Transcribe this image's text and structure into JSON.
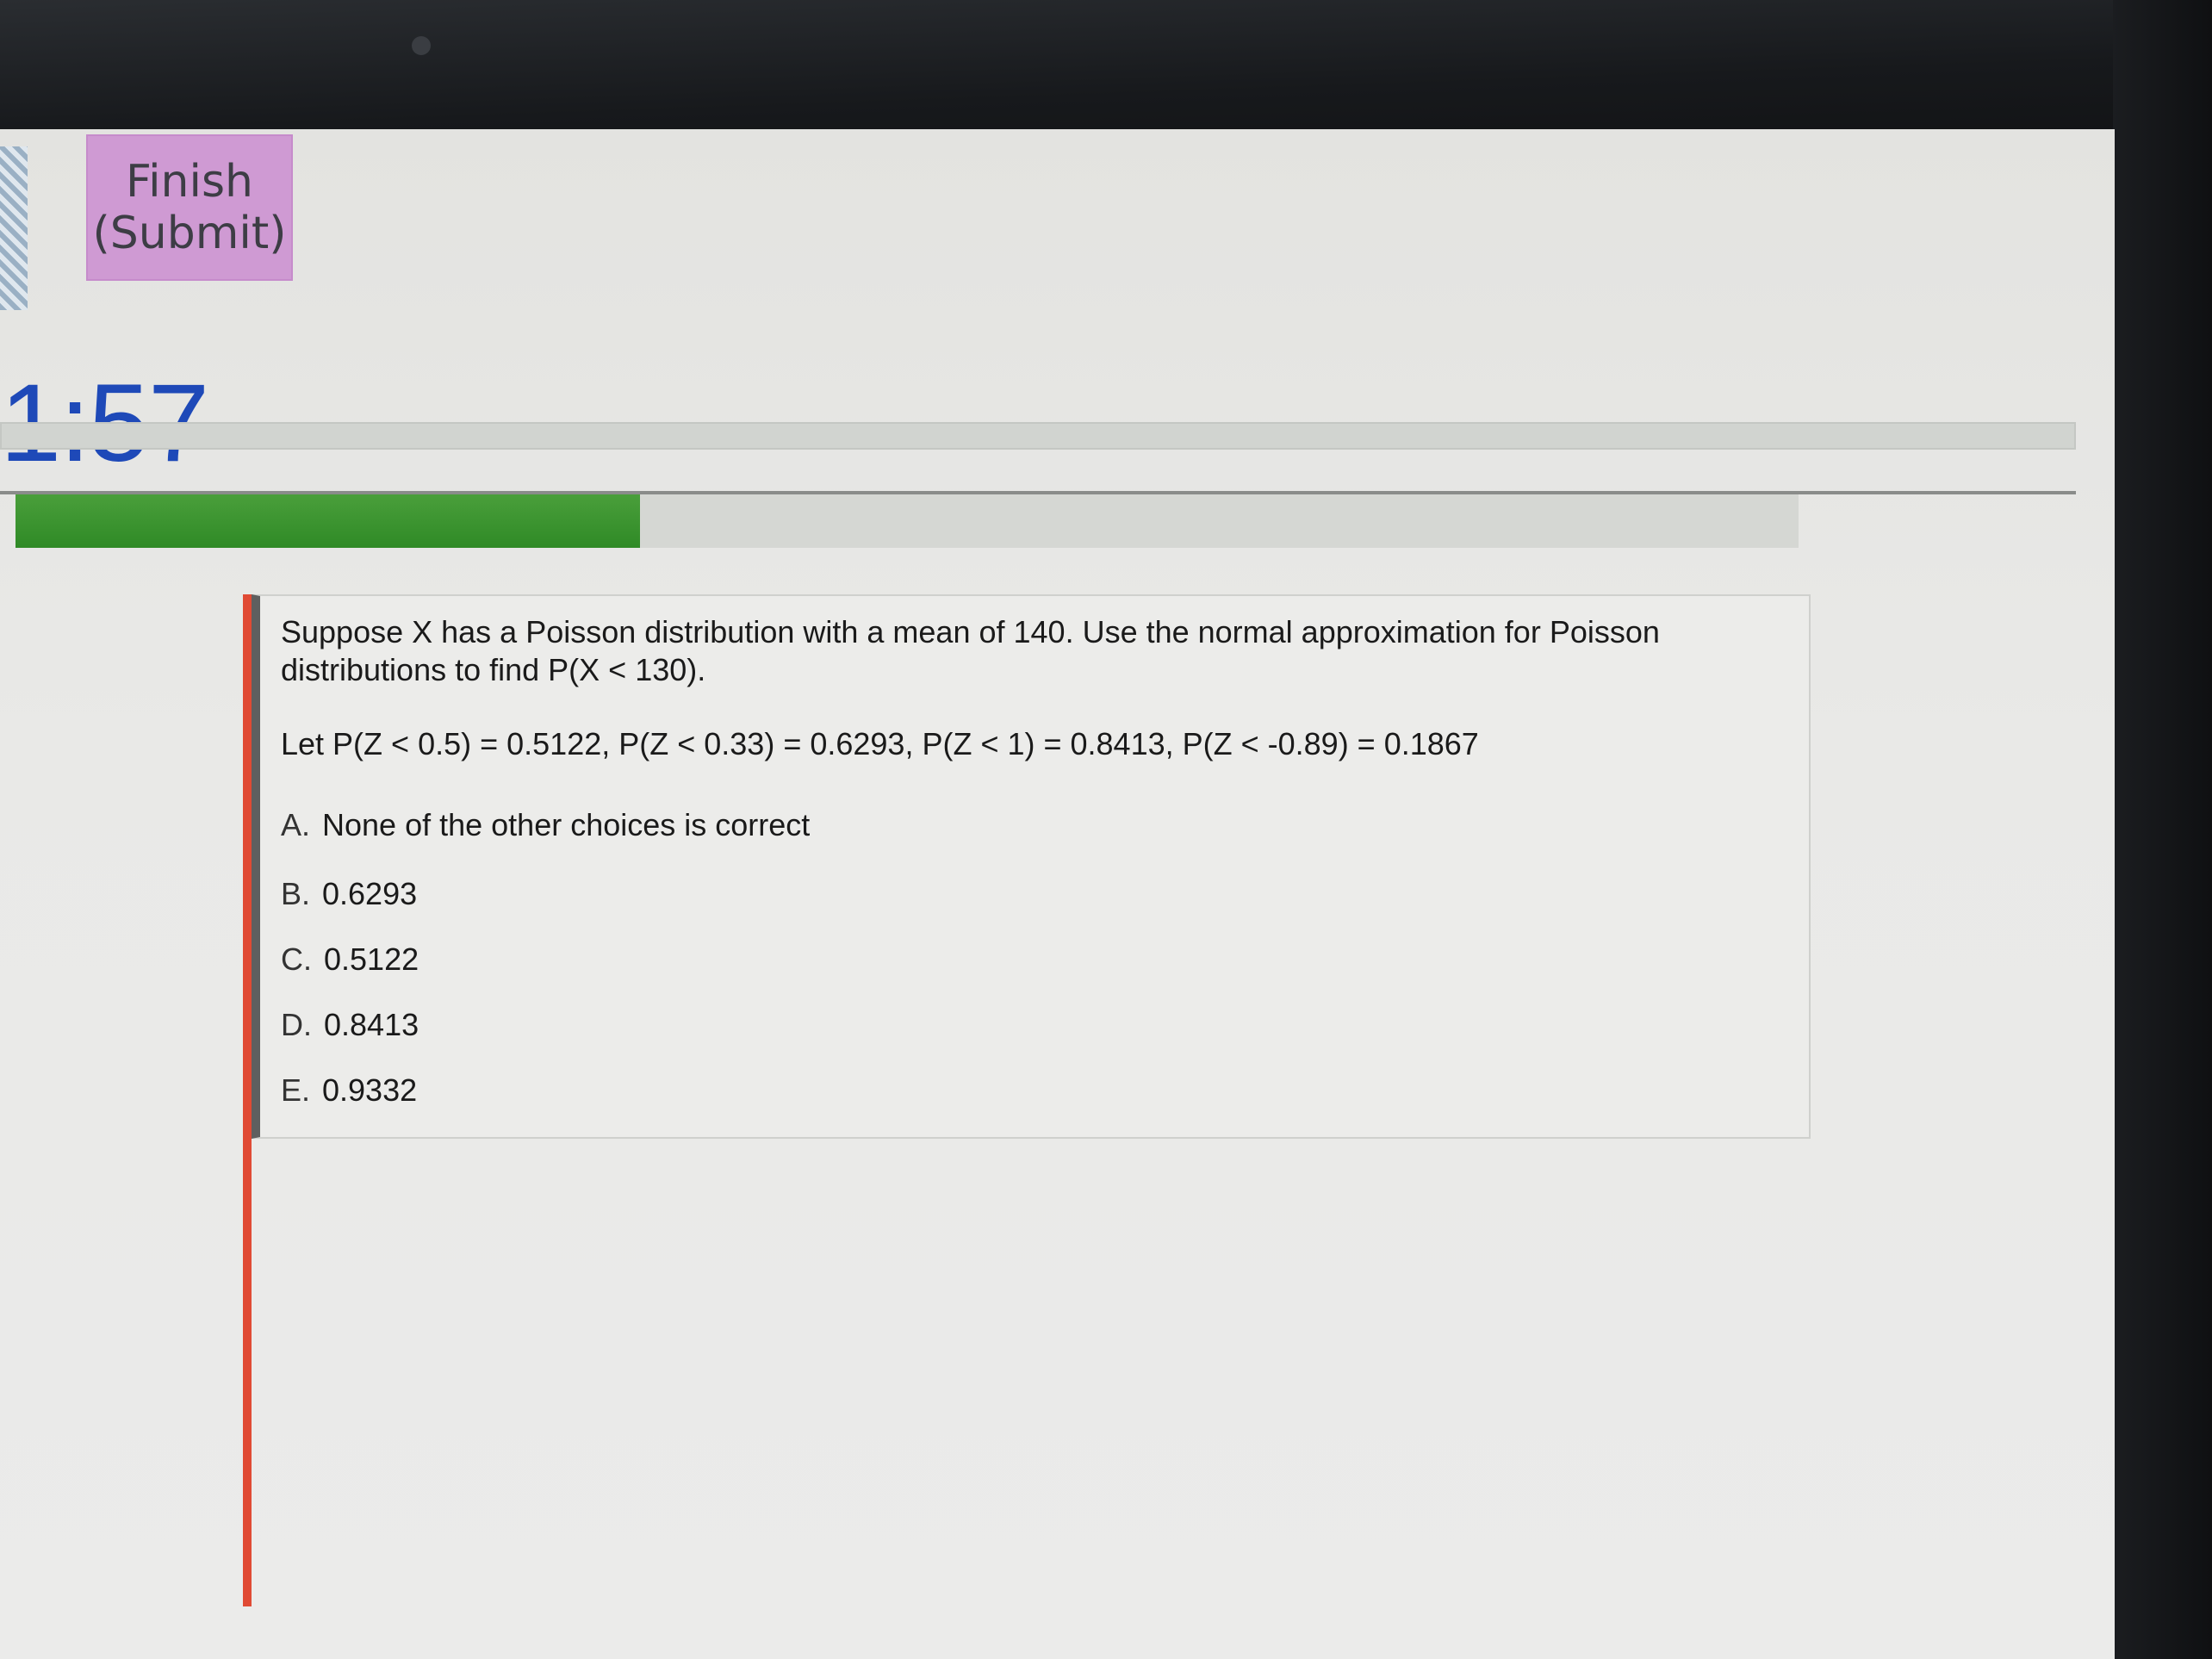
{
  "finish_button": {
    "line1": "Finish",
    "line2": "(Submit)"
  },
  "timer": {
    "display": "1:57",
    "progress_fraction": 0.35
  },
  "question": {
    "text": "Suppose X has a Poisson distribution with a mean of 140. Use the normal approximation for Poisson distributions to find P(X < 130).",
    "given": "Let  P(Z < 0.5) = 0.5122, P(Z < 0.33) = 0.6293, P(Z < 1) = 0.8413, P(Z < -0.89) = 0.1867",
    "choices": [
      {
        "letter": "A.",
        "text": "None of the other choices is correct"
      },
      {
        "letter": "B.",
        "text": "0.6293"
      },
      {
        "letter": "C.",
        "text": "0.5122"
      },
      {
        "letter": "D.",
        "text": "0.8413"
      },
      {
        "letter": "E.",
        "text": "0.9332"
      }
    ]
  },
  "colors": {
    "finish_button": "#cf9ad3",
    "timer_text": "#1e49b8",
    "progress": "#2f8a26",
    "accent": "#e04a34"
  }
}
